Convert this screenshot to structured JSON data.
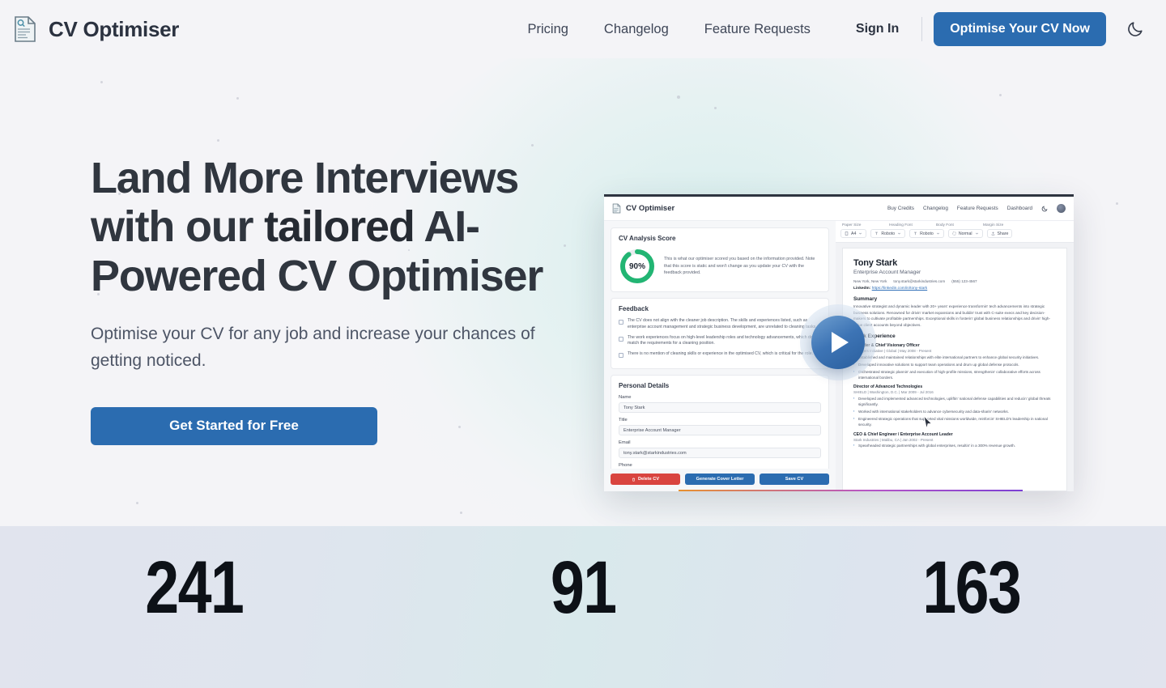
{
  "header": {
    "brand": "CV Optimiser",
    "brand_icon": "document-search-icon",
    "nav": [
      {
        "label": "Pricing"
      },
      {
        "label": "Changelog"
      },
      {
        "label": "Feature Requests"
      }
    ],
    "signin": "Sign In",
    "cta": "Optimise Your CV Now",
    "theme_toggle_icon": "moon-icon",
    "accent": "#2b6cb0"
  },
  "hero": {
    "headline_before": "Land More Interviews with our ",
    "headline_rotating": "tailored",
    "headline_after": " AI-Powered CV Optimiser",
    "subhead": "Optimise your CV for any job and increase your chances of getting noticed.",
    "cta": "Get Started for Free",
    "play_icon": "play-icon",
    "background": "#f4f4f7",
    "glow": "#d0edeb"
  },
  "mockup": {
    "brand": "CV Optimiser",
    "nav": [
      {
        "label": "Buy Credits"
      },
      {
        "label": "Changelog"
      },
      {
        "label": "Feature Requests"
      },
      {
        "label": "Dashboard"
      }
    ],
    "theme_toggle_icon": "moon-icon",
    "avatar_icon": "user-avatar",
    "score": {
      "title": "CV Analysis Score",
      "value": "90%",
      "percent": 90,
      "ring_color": "#22b573",
      "note": "This is what our optimiser scored you based on the information provided. Note that this score is static and won't change as you update your CV with the feedback provided."
    },
    "feedback": {
      "title": "Feedback",
      "items": [
        "The CV does not align with the cleaner job description. The skills and experiences listed, such as enterprise account management and strategic business development, are unrelated to cleaning tasks.",
        "The work experiences focus on high-level leadership roles and technology advancements, which do not match the requirements for a cleaning position.",
        "There is no mention of cleaning skills or experience in the optimised CV, which is critical for the role."
      ]
    },
    "personal_details": {
      "title": "Personal Details",
      "fields": [
        {
          "label": "Name",
          "value": "Tony Stark"
        },
        {
          "label": "Title",
          "value": "Enterprise Account Manager"
        },
        {
          "label": "Email",
          "value": "tony.stark@starkindustries.com"
        },
        {
          "label": "Phone",
          "value": ""
        }
      ]
    },
    "actions": {
      "delete": "Delete CV",
      "delete_icon": "trash-icon",
      "cover_letter": "Generate Cover Letter",
      "save": "Save CV"
    },
    "toolbar": {
      "labels": [
        "Paper Size",
        "Heading Font",
        "Body Font",
        "Margin Size"
      ],
      "paper_size": "A4",
      "heading_font": "Roboto",
      "body_font": "Roboto",
      "margin_size": "Normal",
      "share": "Share",
      "share_icon": "share-icon"
    },
    "cv": {
      "name": "Tony Stark",
      "title": "Enterprise Account Manager",
      "location": "New York, New York",
      "email": "tony.stark@starkindustries.com",
      "phone": "(555) 123-4567",
      "linkedin_label": "LinkedIn:",
      "linkedin_url": "https://linkedin.com/in/tony-stark",
      "summary_heading": "Summary",
      "summary": "Innovative strategist and dynamic leader with 20+ years' experience transformin' tech advancements into strategic business solutions. Renowned for drivin' market expansions and buildin' trust with C-suite execs and key decision-makers to cultivate profitable partnerships. Exceptional skills in fosterin' global business relationships and drivin' high-value client accounts beyond objectives.",
      "experience_heading": "Work Experience",
      "jobs": [
        {
          "role": "Founder & Chief Visionary Officer",
          "meta": "Avengers Initiative | Global | May 2008 - Present",
          "bullets": [
            "Established and maintained relationships with elite international partners to enhance global security initiatives.",
            "Developed innovative solutions to support team operations and drum up global defense protocols.",
            "Orchestrated strategic plannin' and execution of high-profile missions, strengthenin' collaborative efforts across international borders."
          ]
        },
        {
          "role": "Director of Advanced Technologies",
          "meta": "SHIELD | Washington, D.C. | Mar 2009 - Jul 2016",
          "bullets": [
            "Developed and implemented advanced technologies, upliftin' national defense capabilities and reducin' global threats significantly.",
            "Worked with international stakeholders to advance cybersecurity and data-sharin' networks.",
            "Engineered strategic operations that supported vital missions worldwide, reinforcin' SHIELD's leadership in national security."
          ]
        },
        {
          "role": "CEO & Chief Engineer / Enterprise Account Leader",
          "meta": "Stark Industries | Malibu, CA | Jan 2002 - Present",
          "bullets": [
            "Spearheaded strategic partnerships with global enterprises, resultin' in a 300% revenue growth."
          ]
        }
      ]
    }
  },
  "stats": {
    "items": [
      {
        "value": "241"
      },
      {
        "value": "91"
      },
      {
        "value": "163"
      }
    ]
  }
}
